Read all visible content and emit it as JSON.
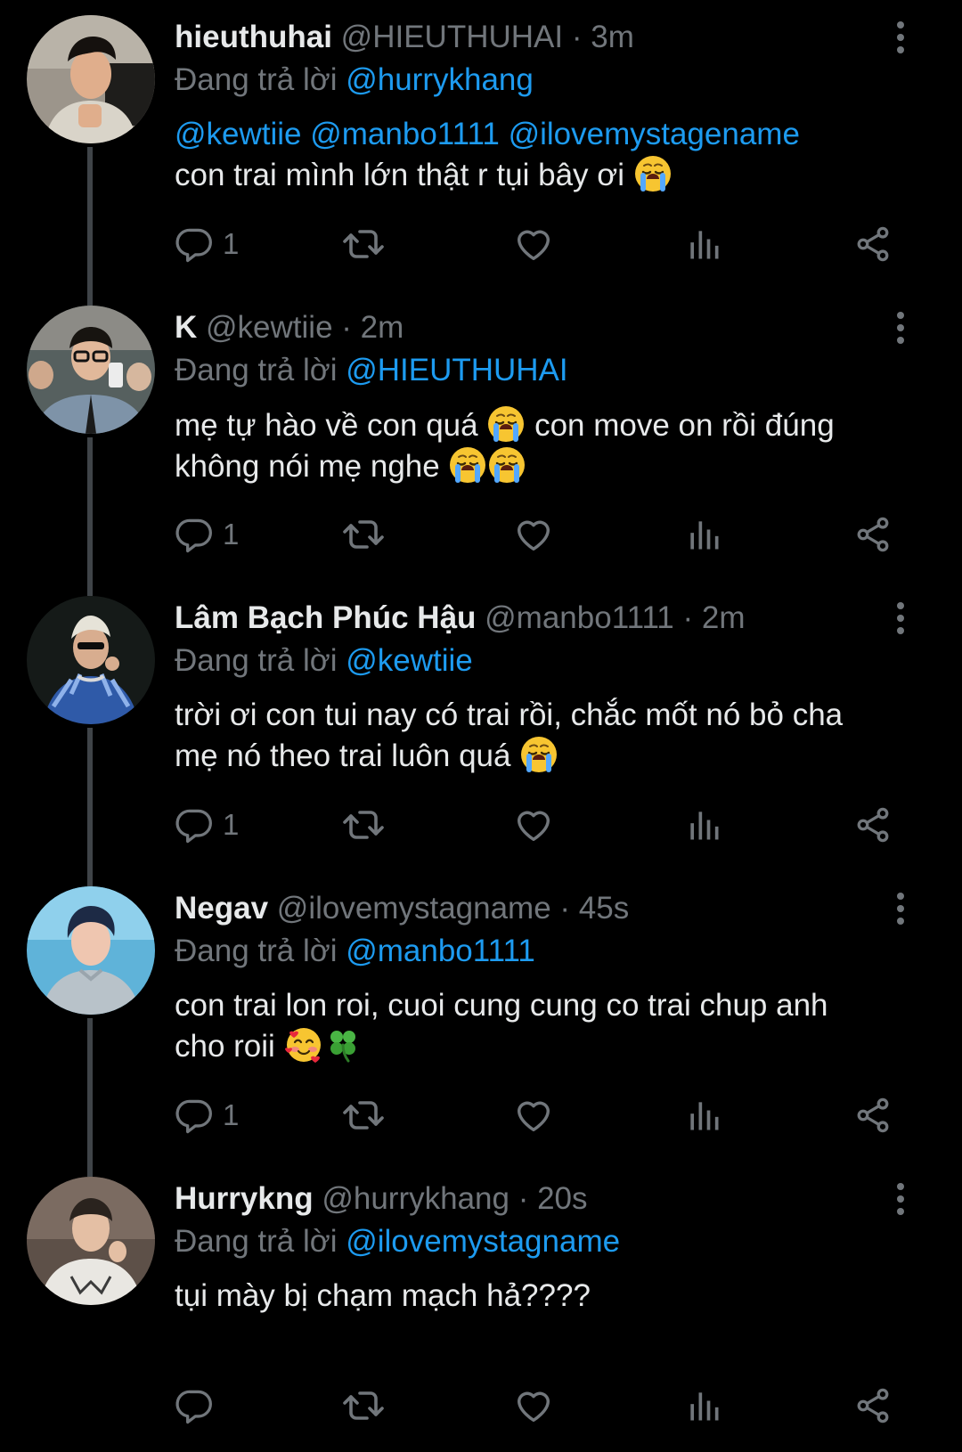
{
  "colors": {
    "background": "#000000",
    "text": "#e7e9ea",
    "secondary": "#71767b",
    "link": "#1d9bf0",
    "thread_line": "#3f4448"
  },
  "reply_prefix": "Đang trả lời",
  "tweets": [
    {
      "name": "hieuthuhai",
      "handle": "@HIEUTHUHAI",
      "separator": "·",
      "time": "3m",
      "reply_to": "@hurrykhang",
      "mentions": "@kewtiie @manbo1111 @ilovemystagename",
      "text": "con trai mình lớn thật r tụi bây ơi",
      "emojis": [
        "crying-face"
      ],
      "reply_count": "1"
    },
    {
      "name": "K",
      "handle": "@kewtiie",
      "separator": "·",
      "time": "2m",
      "reply_to": "@HIEUTHUHAI",
      "text_line1": "mẹ tự hào về con quá",
      "text_line1_after": "con move on rồi đúng",
      "text_line2": "không nói mẹ nghe",
      "emojis": [
        "crying-face",
        "crying-face",
        "crying-face"
      ],
      "reply_count": "1"
    },
    {
      "name": "Lâm Bạch Phúc Hậu",
      "handle": "@manbo1111",
      "separator": "·",
      "time": "2m",
      "reply_to": "@kewtiie",
      "text_line1": "trời ơi con tui nay có trai rồi, chắc mốt nó bỏ cha",
      "text_line2": "mẹ nó theo trai luôn quá",
      "emojis": [
        "crying-face"
      ],
      "reply_count": "1"
    },
    {
      "name": "Negav",
      "handle": "@ilovemystagname",
      "separator": "·",
      "time": "45s",
      "reply_to": "@manbo1111",
      "text_line1": "con trai lon roi, cuoi cung cung co trai chup anh",
      "text_line2": "cho roii",
      "emojis": [
        "smiling-face-with-hearts",
        "four-leaf-clover"
      ],
      "reply_count": "1"
    },
    {
      "name": "Hurrykng",
      "handle": "@hurrykhang",
      "separator": "·",
      "time": "20s",
      "reply_to": "@ilovemystagname",
      "text": "tụi mày bị chạm mạch hả????",
      "emojis": [],
      "reply_count": ""
    }
  ],
  "icons": {
    "reply": "reply-icon",
    "retweet": "retweet-icon",
    "like": "heart-icon",
    "views": "views-icon",
    "share": "share-icon",
    "more": "more-options-icon"
  }
}
